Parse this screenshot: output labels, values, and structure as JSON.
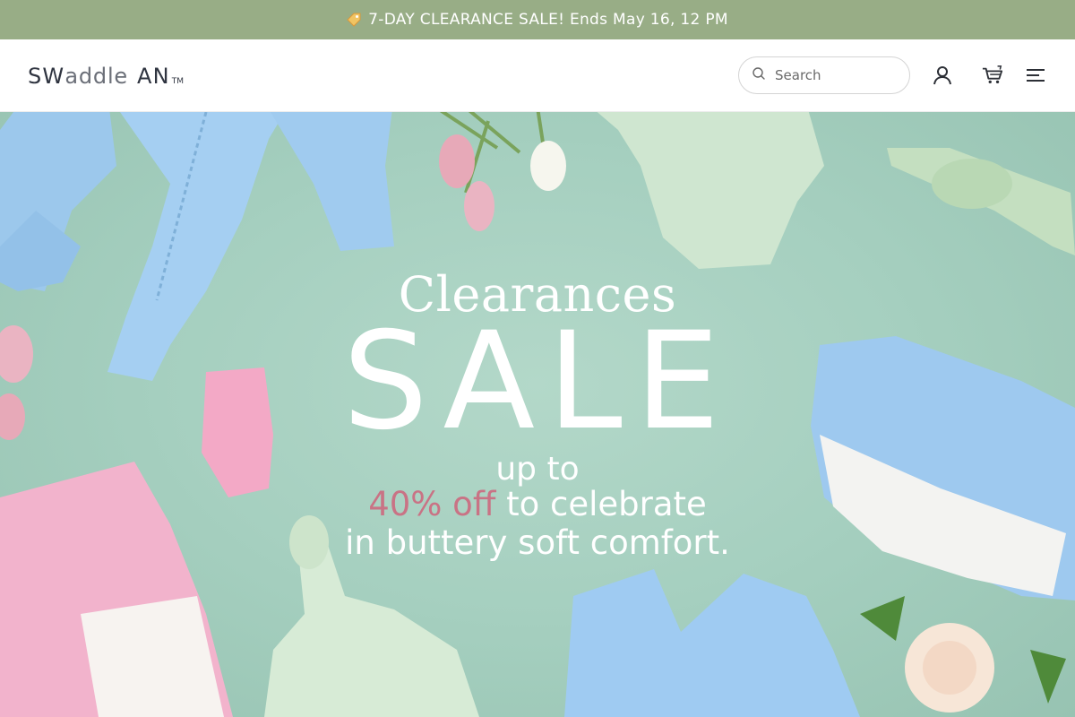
{
  "announcement": {
    "icon": "price-tag-icon",
    "text": "7-DAY CLEARANCE SALE! Ends May 16, 12 PM",
    "background": "#98ad86"
  },
  "header": {
    "logo": {
      "bold_a": "SW",
      "light": "addle",
      "bold_b": "AN",
      "tm": "TM"
    },
    "search": {
      "placeholder": "Search",
      "value": "",
      "icon": "search-icon"
    },
    "icons": [
      "account-icon",
      "cart-icon",
      "menu-icon"
    ]
  },
  "hero": {
    "kicker": "Clearances",
    "headline": "SALE",
    "line1": "up to",
    "line2_accent": "40% off",
    "line2_rest": " to celebrate",
    "line3": "in buttery soft comfort.",
    "accent_color": "#c97385",
    "background_color": "#a5cfbf"
  }
}
